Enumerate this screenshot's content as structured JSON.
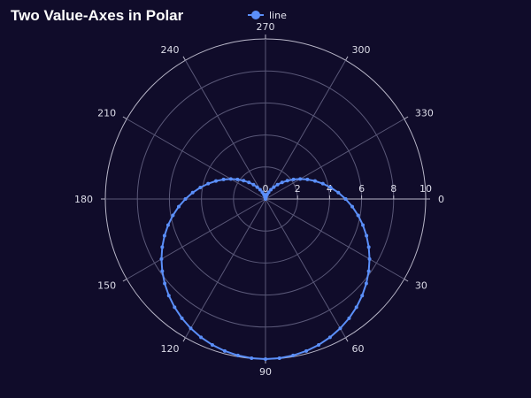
{
  "title": "Two Value-Axes in Polar",
  "colors": {
    "background": "#100c2a",
    "grid": "#5a5878",
    "outer_ring": "#b8b6c8",
    "series": "#5b8ff9",
    "text": "#dcdce8"
  },
  "chart_data": {
    "type": "line",
    "coordinate_system": "polar",
    "title": "Two Value-Axes in Polar",
    "legend": {
      "position": "top-center",
      "entries": [
        "line"
      ]
    },
    "angle_axis": {
      "min": 0,
      "max": 360,
      "clockwise": true,
      "start_direction": "east",
      "tick_labels": [
        "0",
        "30",
        "60",
        "90",
        "120",
        "150",
        "180",
        "210",
        "240",
        "270",
        "300",
        "330"
      ]
    },
    "radius_axis": {
      "min": 0,
      "max": 10,
      "tick_labels": [
        "0",
        "2",
        "4",
        "6",
        "8",
        "10"
      ],
      "label_direction": "along angle 0"
    },
    "grid": true,
    "series": [
      {
        "name": "line",
        "formula": "r = 5 * (1 + sin(theta))",
        "theta_deg_start": 0,
        "theta_deg_end": 360,
        "theta_deg_step": 5,
        "marker": "circle"
      }
    ]
  }
}
